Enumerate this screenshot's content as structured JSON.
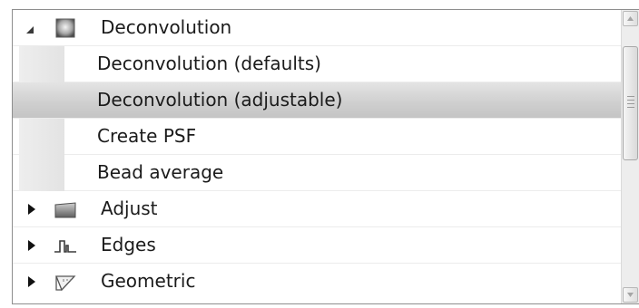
{
  "tree": {
    "categories": [
      {
        "label": "Deconvolution",
        "icon": "deconvolution-icon",
        "expanded": true,
        "children": [
          {
            "label": "Deconvolution (defaults)",
            "selected": false
          },
          {
            "label": "Deconvolution (adjustable)",
            "selected": true
          },
          {
            "label": "Create PSF",
            "selected": false
          },
          {
            "label": "Bead average",
            "selected": false
          }
        ]
      },
      {
        "label": "Adjust",
        "icon": "adjust-icon",
        "expanded": false
      },
      {
        "label": "Edges",
        "icon": "edges-icon",
        "expanded": false
      },
      {
        "label": "Geometric",
        "icon": "geometric-icon",
        "expanded": false
      }
    ]
  },
  "scrollbar": {
    "position": 0.0,
    "visible_fraction": 0.45
  },
  "colors": {
    "selection": "#cfcfcf",
    "border": "#8e8e8e",
    "text": "#1b1b1b"
  }
}
